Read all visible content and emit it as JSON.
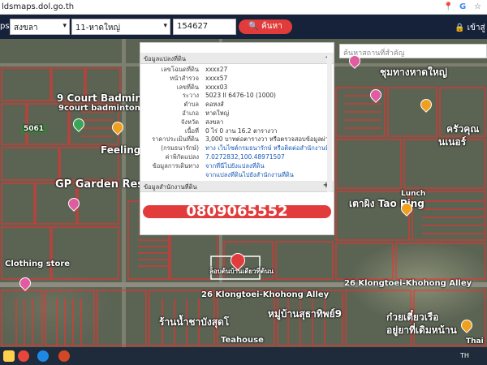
{
  "browser": {
    "url": "ldsmaps.dol.go.th"
  },
  "toolbar": {
    "brand": "ps",
    "province": "สงขลา",
    "district": "11-หาดใหญ่",
    "parcel_no": "154627",
    "search_label": "ค้นหา",
    "login_label": "เข้าสู่"
  },
  "map": {
    "search_placeholder": "ค้นหาสถานที่สำคัญ",
    "labels": {
      "court_badminton": "9 Court Badmin",
      "court_badminton_sub": "9court badminton",
      "road_5061": "5061",
      "feeling": "Feeling",
      "gp_garden": "GP Garden Reso",
      "cloth_store": "Clothing store",
      "tao_ping": "เตาผิง Tao Ping",
      "lunch": "Lunch",
      "alley_left": "26 Klongtoei-Khohong Alley",
      "alley_right": "26 Klongtoei-Khohong Alley",
      "village": "หมู่บ้านสุธาทิพย์9",
      "teahouse": "Teahouse",
      "shop_left": "ร้านน้ำชาบังสุดโ",
      "noodle": "ก๋วยเตี๋ยวเรือ",
      "noodle2": "อยู่ยาที่เดิมหน้าน",
      "top_right": "ชุมทางหาดใหญ่",
      "right_mid": "ครัวคุณ",
      "right_mid2": "นเนอร์",
      "thai": "Thai",
      "selected_parcel": "ล็อบต้นบ้านเดียวที่ต้นน"
    }
  },
  "panel": {
    "section1_title": "ข้อมูลแปลงที่ดิน",
    "section2_title": "ข้อมูลสำนักงานที่ดิน",
    "rows": [
      {
        "k": "เลขโฉนดที่ดิน",
        "v": "xxxx27"
      },
      {
        "k": "หน้าสำรวจ",
        "v": "xxxx57"
      },
      {
        "k": "เลขที่ดิน",
        "v": "xxxx03"
      },
      {
        "k": "ระวาง",
        "v": "5023 II 6476-10 (1000)"
      },
      {
        "k": "ตำบล",
        "v": "คอหงส์"
      },
      {
        "k": "อำเภอ",
        "v": "หาดใหญ่"
      },
      {
        "k": "จังหวัด",
        "v": "สงขลา"
      },
      {
        "k": "เนื้อที่",
        "v": "0 ไร่ 0 งาน 16.2 ตารางวา"
      },
      {
        "k": "ราคาประเมินที่ดิน",
        "v": "3,000 บาทต่อตารางวา หรือตรวจสอบข้อมูลผ่าน"
      },
      {
        "k": "(กรมธนารักษ์)",
        "v": "ทาง เว็บไซต์กรมธนารักษ์ หรือติดต่อสำนักงานที่ดิน",
        "link": true
      },
      {
        "k": "ค่าพิกัดแปลง",
        "v": "7.0272832,100.48971507",
        "link": true
      },
      {
        "k": "ข้อมูลการเดินทาง",
        "v": "จากที่นี่ไปยังแปลงที่ดิน",
        "link": true
      },
      {
        "k": "",
        "v": "จากแปลงที่ดินไปยังสำนักงานที่ดิน",
        "link": true
      }
    ],
    "toggle_minus": "–",
    "toggle_plus": "+",
    "phone": "0809065552"
  },
  "taskbar": {
    "lang": "TH"
  },
  "colors": {
    "parcel_line": "#ff2a2a",
    "accent": "#e23b3b",
    "toolbar": "#16213a"
  }
}
